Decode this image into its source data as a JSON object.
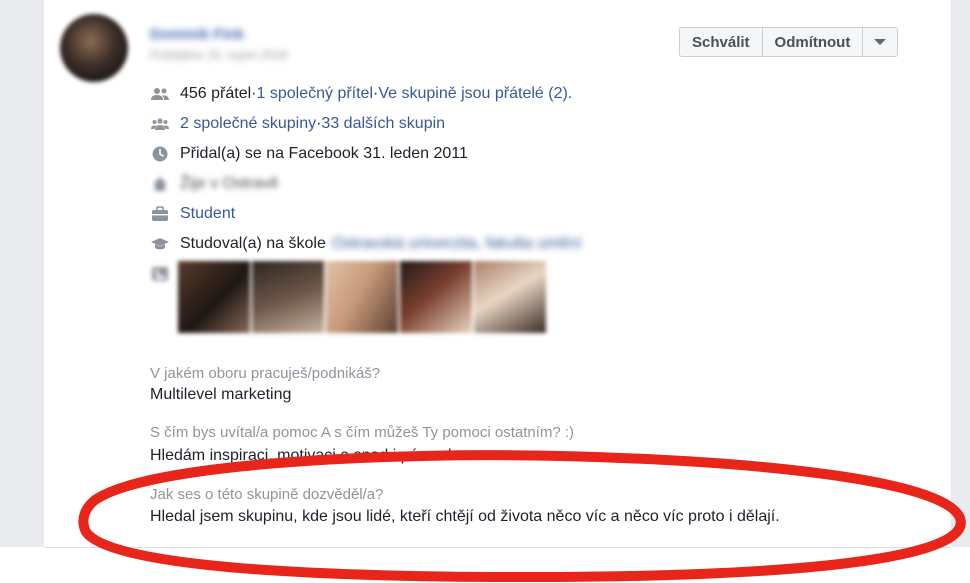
{
  "request": {
    "name": "Dominik Fink",
    "request_date": "Požádáno 15. srpen 2018",
    "actions": {
      "approve_label": "Schválit",
      "decline_label": "Odmítnout",
      "more_icon": "caret-down-icon"
    },
    "details": {
      "friends_count": "456 přátel",
      "mutual_friend": "1 společný přítel",
      "friends_in_group": "Ve skupině jsou přátelé (2).",
      "mutual_groups": "2 společné skupiny",
      "other_groups": "33 dalších skupin",
      "joined": "Přidal(a) se na Facebook 31. leden 2011",
      "location": "Žije v Ostravě",
      "work": "Student",
      "education_prefix": "Studoval(a) na škole",
      "education_school": "Ostravská univerzita, fakulta umění",
      "separator": " · "
    },
    "photos_count": 5,
    "photo_colors": [
      "#5a3a2c",
      "#2d2621",
      "#c79a7a",
      "#7a3f2e",
      "#a8806a"
    ],
    "questions": [
      {
        "q": "V jakém oboru pracuješ/podnikáš?",
        "a": "Multilevel marketing"
      },
      {
        "q": "S čím bys uvítal/a pomoc A s čím můžeš Ty pomoci ostatním? :)",
        "a": "Hledám inspiraci, motivaci a snad i pár rad"
      },
      {
        "q": "Jak ses o této skupině dozvěděl/a?",
        "a": "Hledal jsem skupinu, kde jsou lidé, kteří chtějí od života něco víc a něco víc proto i dělají."
      }
    ]
  },
  "annotation_color": "#e8251b"
}
